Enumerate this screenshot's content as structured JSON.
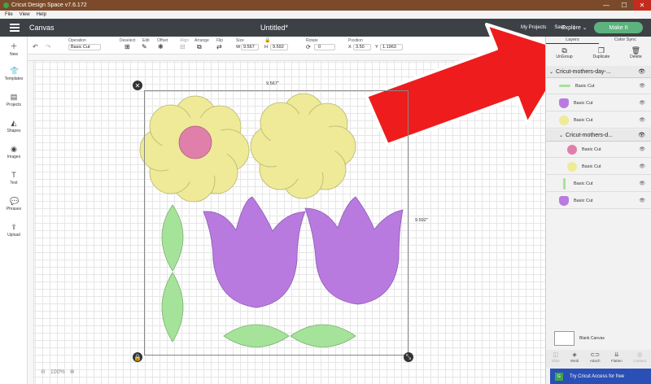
{
  "window": {
    "title": "Cricut Design Space  v7.6.172",
    "controls": [
      "—",
      "☐",
      "✕"
    ]
  },
  "menu": [
    "File",
    "View",
    "Help"
  ],
  "header": {
    "section": "Canvas",
    "doc_title": "Untitled*",
    "links": [
      "My Projects",
      "Save",
      "|"
    ],
    "explore": "Explore  ⌄",
    "make_it": "Make It"
  },
  "toolbar": {
    "operation_label": "Operation",
    "operation_value": "Basic Cut",
    "deselect": "Deselect",
    "edit": "Edit",
    "offset": "Offset",
    "align": "Align",
    "arrange": "Arrange",
    "flip": "Flip",
    "size_label": "Size",
    "w_label": "W",
    "w_value": "9.567",
    "h_label": "H",
    "h_value": "9.592",
    "rotate_label": "Rotate",
    "rotate_value": "0",
    "position_label": "Position",
    "x_label": "X",
    "x_value": "3.50",
    "y_label": "Y",
    "y_value": "1.1963"
  },
  "leftbar": [
    {
      "label": "New",
      "icon": "plus-icon"
    },
    {
      "label": "Templates",
      "icon": "shirt-icon"
    },
    {
      "label": "Projects",
      "icon": "projects-icon"
    },
    {
      "label": "Shapes",
      "icon": "shapes-icon"
    },
    {
      "label": "Images",
      "icon": "images-icon"
    },
    {
      "label": "Text",
      "icon": "text-icon"
    },
    {
      "label": "Phrases",
      "icon": "phrases-icon"
    },
    {
      "label": "Upload",
      "icon": "upload-icon"
    }
  ],
  "canvas": {
    "width_dim": "9.567\"",
    "height_dim": "9.592\"",
    "zoom": "100%"
  },
  "rightpanel": {
    "tabs": [
      "Layers",
      "Color Sync"
    ],
    "tools": [
      "UnGroup",
      "Duplicate",
      "Delete"
    ],
    "group_title": "Cricut-mothers-day-...",
    "subgroup_title": "Cricut-mothers-d...",
    "layers": [
      {
        "label": "Basic Cut",
        "color": "#a6e39a",
        "shape": "leaf"
      },
      {
        "label": "Basic Cut",
        "color": "#b97ae0",
        "shape": "tulip"
      },
      {
        "label": "Basic Cut",
        "color": "#eeea98",
        "shape": "circle"
      },
      {
        "label": "Basic Cut",
        "color": "#e07faa",
        "shape": "circle"
      },
      {
        "label": "Basic Cut",
        "color": "#eeea98",
        "shape": "circle"
      },
      {
        "label": "Basic Cut",
        "color": "#a6e39a",
        "shape": "stem"
      },
      {
        "label": "Basic Cut",
        "color": "#b97ae0",
        "shape": "tulip"
      }
    ],
    "blank_canvas": "Blank Canvas",
    "bottom_tools": [
      "Slice",
      "Weld",
      "Attach",
      "Flatten",
      "Contour"
    ],
    "access": "Try Cricut Access for free",
    "access_badge": "G"
  },
  "colors": {
    "yellow": "#eeea98",
    "pink": "#e07faa",
    "purple": "#b97ae0",
    "green": "#a6e39a",
    "arrow": "#ee1c1c"
  }
}
